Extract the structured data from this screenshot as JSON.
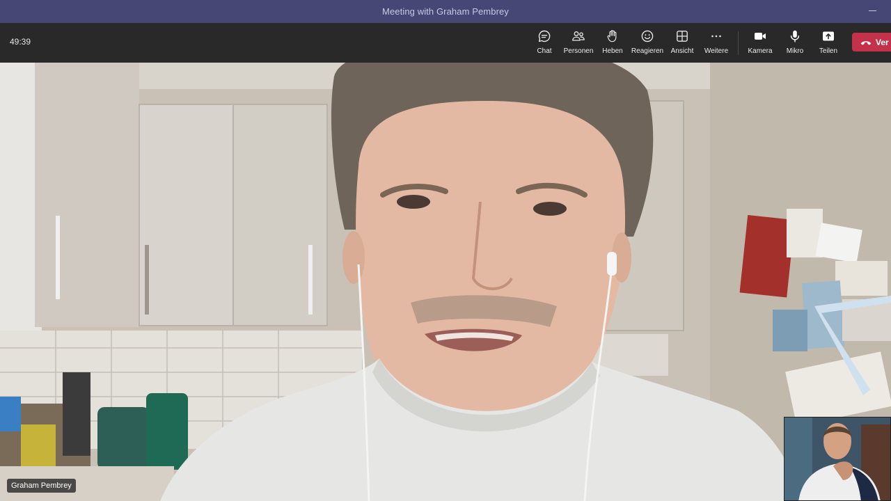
{
  "window": {
    "title": "Meeting with Graham Pembrey"
  },
  "call": {
    "elapsed": "49:39"
  },
  "toolbar": {
    "items": [
      {
        "label": "Chat",
        "icon": "chat-bubble-icon"
      },
      {
        "label": "Personen",
        "icon": "people-icon"
      },
      {
        "label": "Heben",
        "icon": "raise-hand-icon"
      },
      {
        "label": "Reagieren",
        "icon": "smiley-icon"
      },
      {
        "label": "Ansicht",
        "icon": "grid-view-icon"
      },
      {
        "label": "Weitere",
        "icon": "more-dots-icon"
      },
      {
        "label": "Kamera",
        "icon": "camera-icon"
      },
      {
        "label": "Mikro",
        "icon": "microphone-icon"
      },
      {
        "label": "Teilen",
        "icon": "share-tray-icon"
      }
    ],
    "leave_label": "Ver",
    "leave_color": "#c4314b"
  },
  "main_video": {
    "participant_name": "Graham Pembrey"
  },
  "colors": {
    "title_bar": "#464775",
    "toolbar": "#292929"
  }
}
